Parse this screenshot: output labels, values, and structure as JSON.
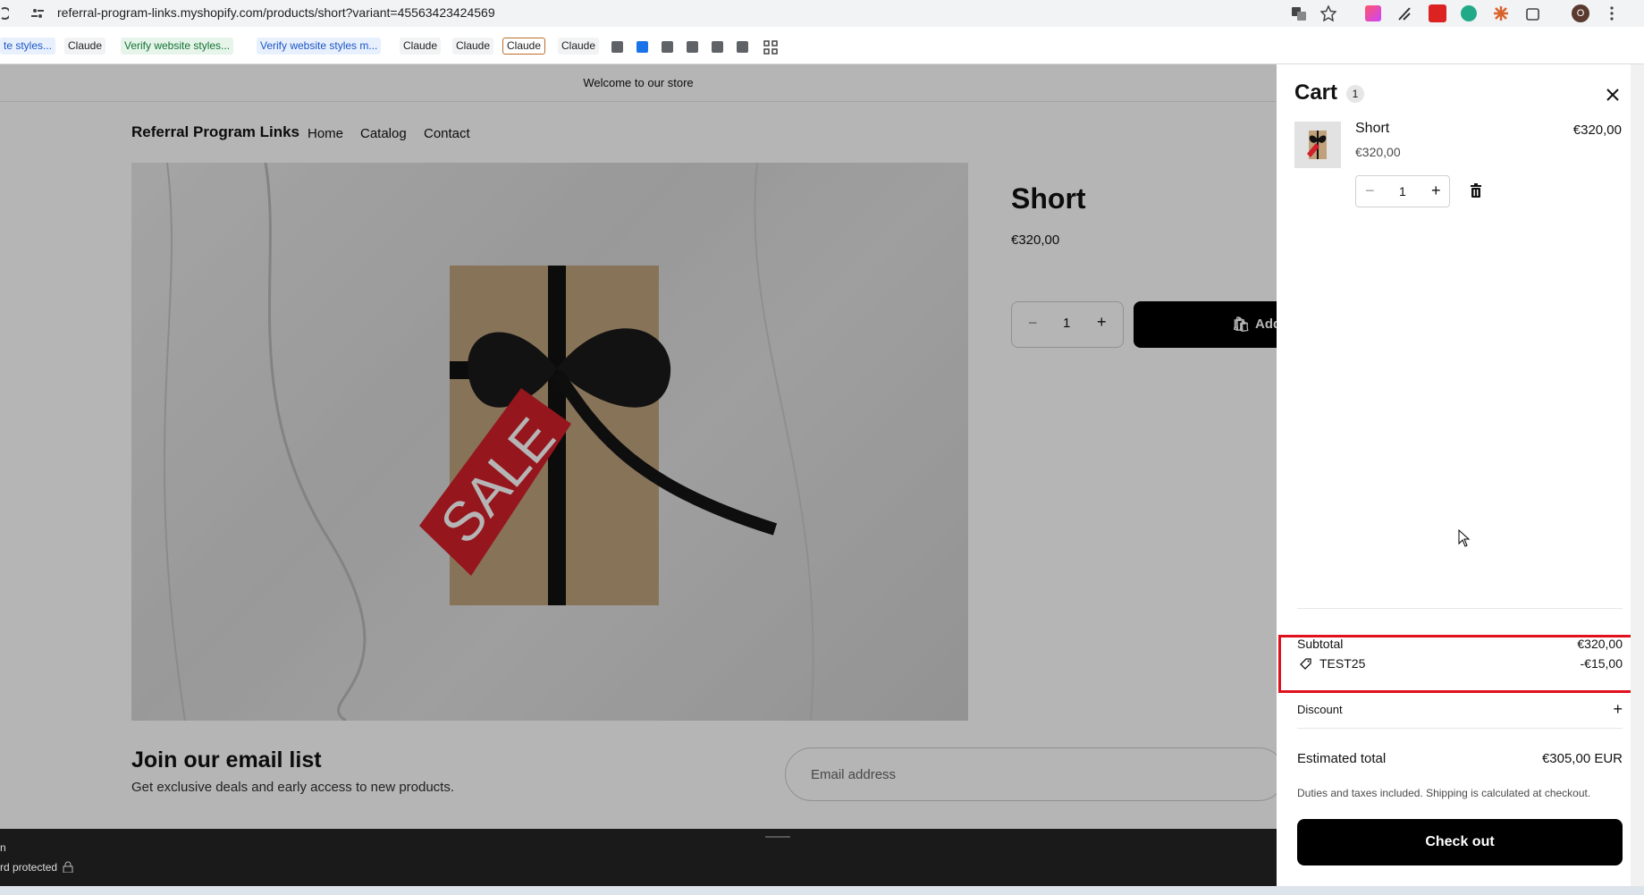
{
  "browser": {
    "url": "referral-program-links.myshopify.com/products/short?variant=45563423424569",
    "bookmarks": [
      "te styles...",
      "Claude",
      "Verify website styles...",
      "Verify website styles m...",
      "Claude",
      "Claude",
      "Claude",
      "Claude"
    ]
  },
  "store": {
    "announcement": "Welcome to our store",
    "brand": "Referral Program Links",
    "nav": [
      "Home",
      "Catalog",
      "Contact"
    ],
    "product": {
      "title": "Short",
      "price": "€320,00",
      "qty": "1",
      "add_label": "Add",
      "sale_tag": "SALE"
    },
    "email": {
      "heading": "Join our email list",
      "subtext": "Get exclusive deals and early access to new products.",
      "placeholder": "Email address"
    },
    "footer_lines": [
      "n",
      "rd protected"
    ]
  },
  "cart": {
    "title": "Cart",
    "count": "1",
    "item": {
      "name": "Short",
      "unit_price": "€320,00",
      "line_total": "€320,00",
      "qty": "1"
    },
    "subtotal_label": "Subtotal",
    "subtotal_value": "€320,00",
    "discount_code": "TEST25",
    "discount_value": "-€15,00",
    "discount_toggle_label": "Discount",
    "estimated_label": "Estimated total",
    "estimated_value": "€305,00 EUR",
    "taxes_note": "Duties and taxes included. Shipping is calculated at checkout.",
    "checkout_label": "Check out"
  },
  "colors": {
    "highlight": "#e0111c",
    "button": "#000000"
  }
}
